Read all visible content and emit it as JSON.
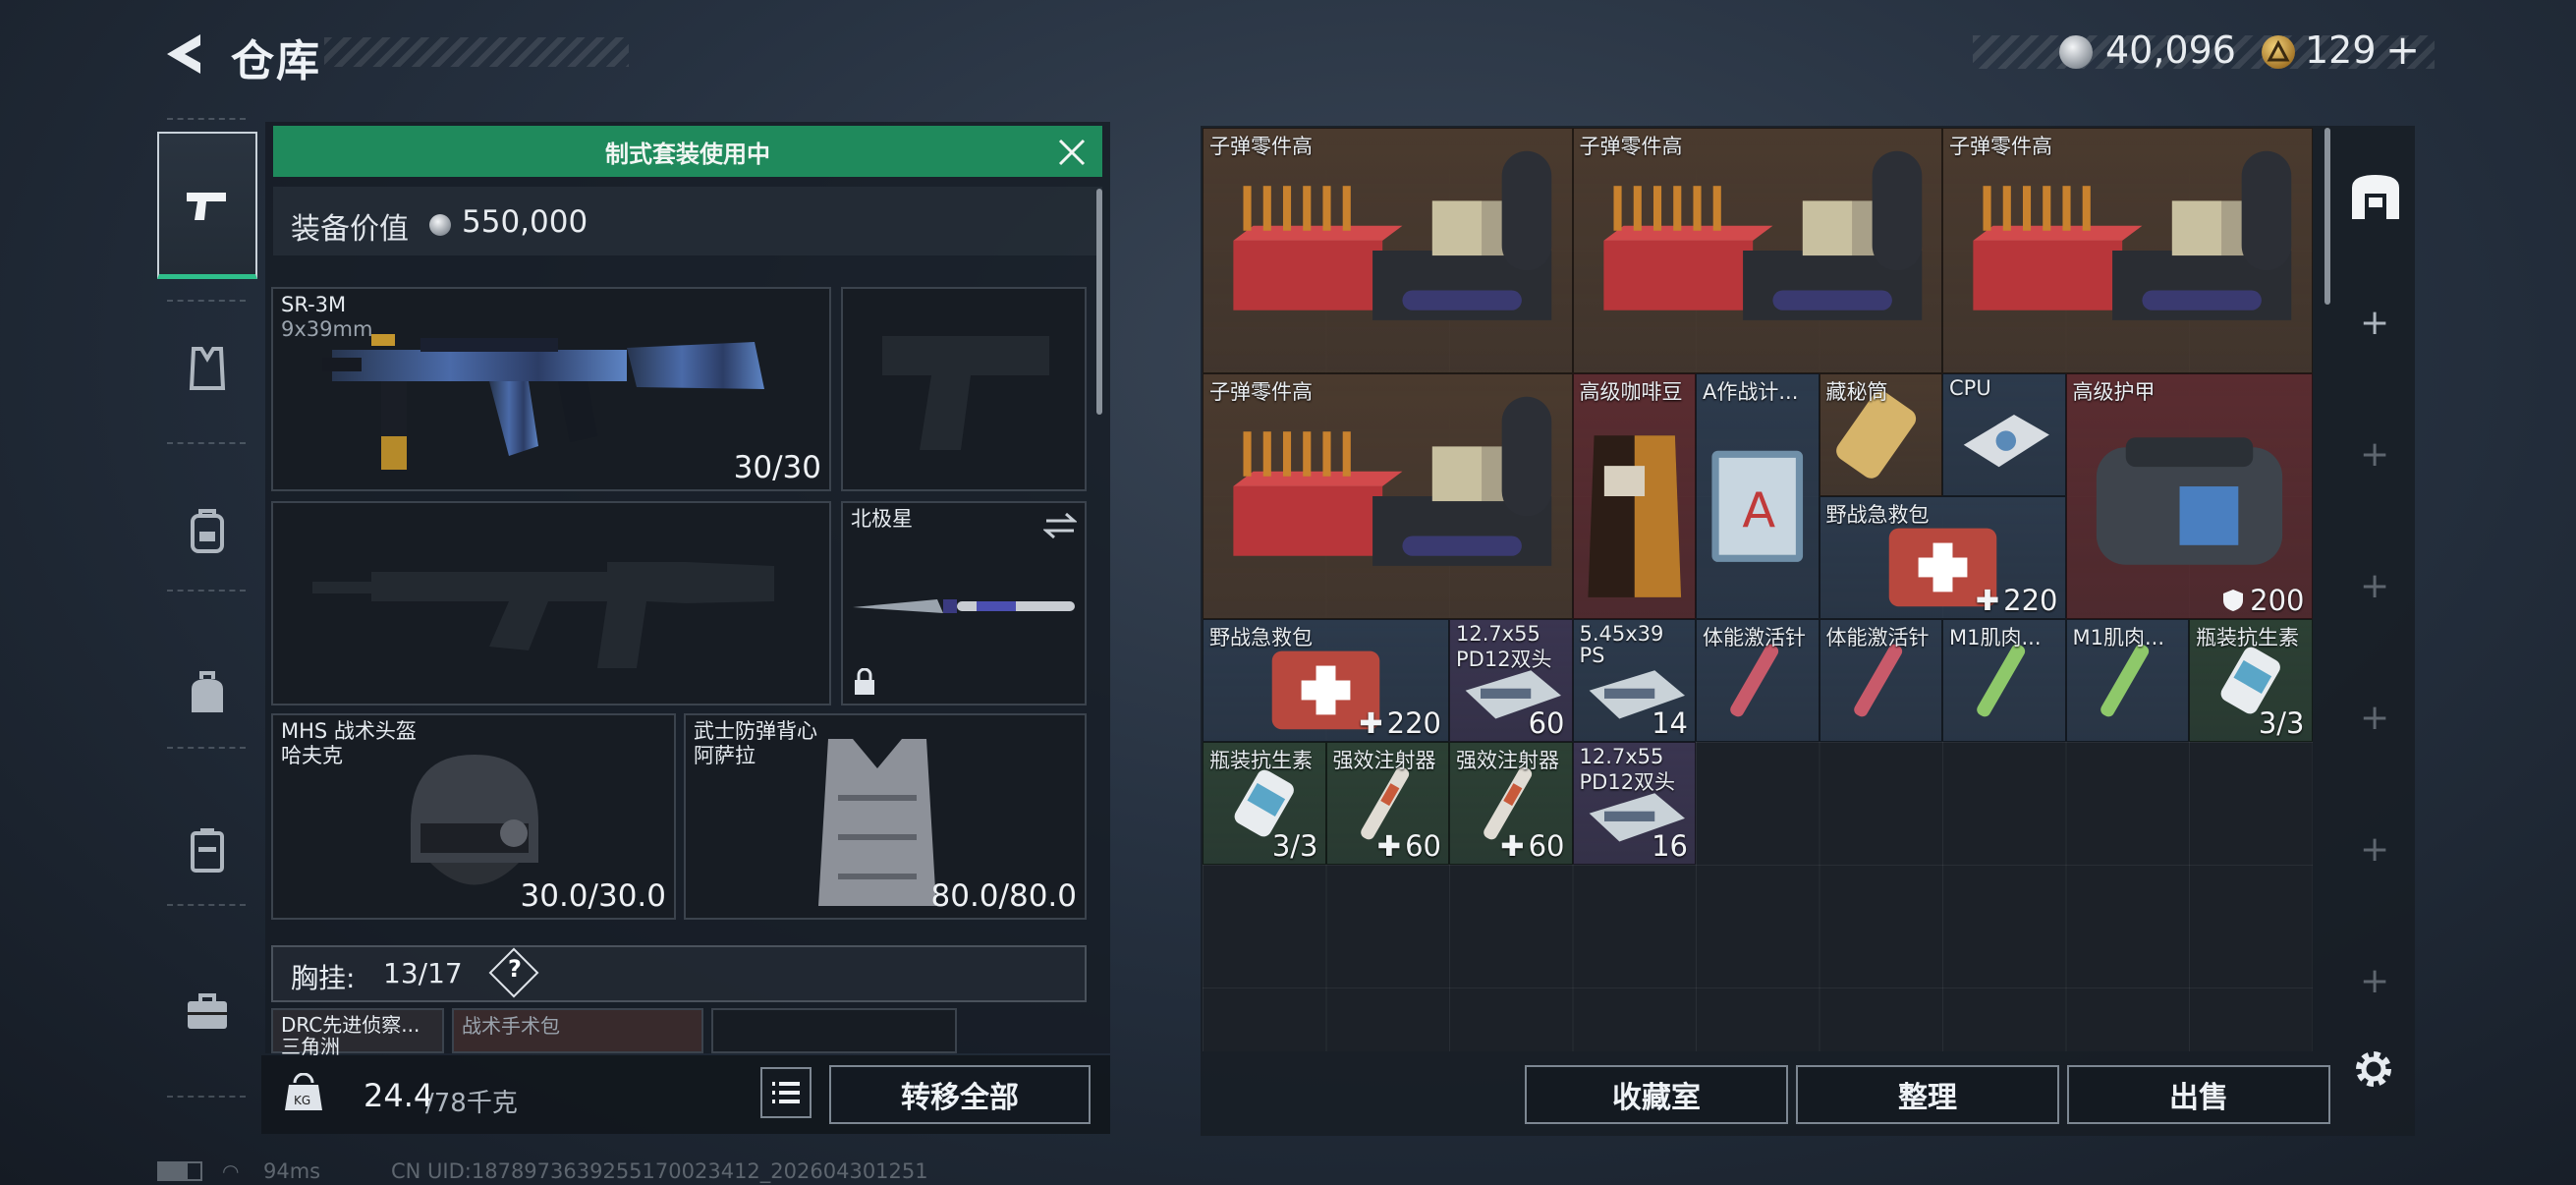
{
  "header": {
    "title": "仓库",
    "coins": "40,096",
    "tokens": "129",
    "plus": "+"
  },
  "sidebar": {
    "items": [
      "weapon-tab",
      "armor-tab",
      "backpack-tab",
      "bag-tab",
      "container-tab",
      "case-tab"
    ]
  },
  "loadout": {
    "banner": "制式套装使用中",
    "value_label": "装备价值",
    "value": "550,000",
    "primary": {
      "name": "SR-3M",
      "ammo": "9x39mm",
      "count": "30/30"
    },
    "knife": {
      "name": "北极星"
    },
    "helmet": {
      "name": "MHS 战术头盔",
      "sub": "哈夫克",
      "durability": "30.0/30.0"
    },
    "vest": {
      "name": "武士防弹背心",
      "sub": "阿萨拉",
      "durability": "80.0/80.0"
    },
    "chest_rig": {
      "label": "胸挂:",
      "capacity": "13/17",
      "help": "?"
    },
    "bags": [
      "DRC先进侦察...",
      "战术手术包"
    ],
    "bag_sub": "三角洲",
    "weight": "24.4",
    "weight_max": "/78千克",
    "transfer_all": "转移全部"
  },
  "stash": {
    "items": [
      {
        "name": "子弹零件高",
        "value": ""
      },
      {
        "name": "子弹零件高",
        "value": ""
      },
      {
        "name": "子弹零件高",
        "value": ""
      },
      {
        "name": "子弹零件高",
        "value": ""
      },
      {
        "name": "高级咖啡豆",
        "value": ""
      },
      {
        "name": "A作战计...",
        "value": ""
      },
      {
        "name": "藏秘筒",
        "value": ""
      },
      {
        "name": "CPU",
        "value": ""
      },
      {
        "name": "高级护甲",
        "value": "200"
      },
      {
        "name": "野战急救包",
        "value": "220"
      },
      {
        "name": "野战急救包",
        "value": "220"
      },
      {
        "name": "12.7x55",
        "sub": "PD12双头",
        "value": "60"
      },
      {
        "name": "5.45x39",
        "sub": "PS",
        "value": "14"
      },
      {
        "name": "体能激活针",
        "value": ""
      },
      {
        "name": "体能激活针",
        "value": ""
      },
      {
        "name": "M1肌肉...",
        "value": ""
      },
      {
        "name": "M1肌肉...",
        "value": ""
      },
      {
        "name": "瓶装抗生素",
        "value": "3/3"
      },
      {
        "name": "瓶装抗生素",
        "value": "3/3"
      },
      {
        "name": "强效注射器",
        "value": "60"
      },
      {
        "name": "强效注射器",
        "value": "60"
      },
      {
        "name": "12.7x55",
        "sub": "PD12双头",
        "value": "16"
      }
    ],
    "buttons": {
      "collection": "收藏室",
      "organize": "整理",
      "sell": "出售"
    }
  },
  "status": {
    "ping": "94ms",
    "uid": "CN UID:1878973639255170023412_202604301251"
  },
  "colors": {
    "accent_green": "#1f8a5c",
    "rare_red": "#5a2c30",
    "epic_purple": "#3a3550",
    "blue": "#2c3a4c",
    "green": "#2c4034",
    "gold_brown": "#4a3a2e"
  }
}
